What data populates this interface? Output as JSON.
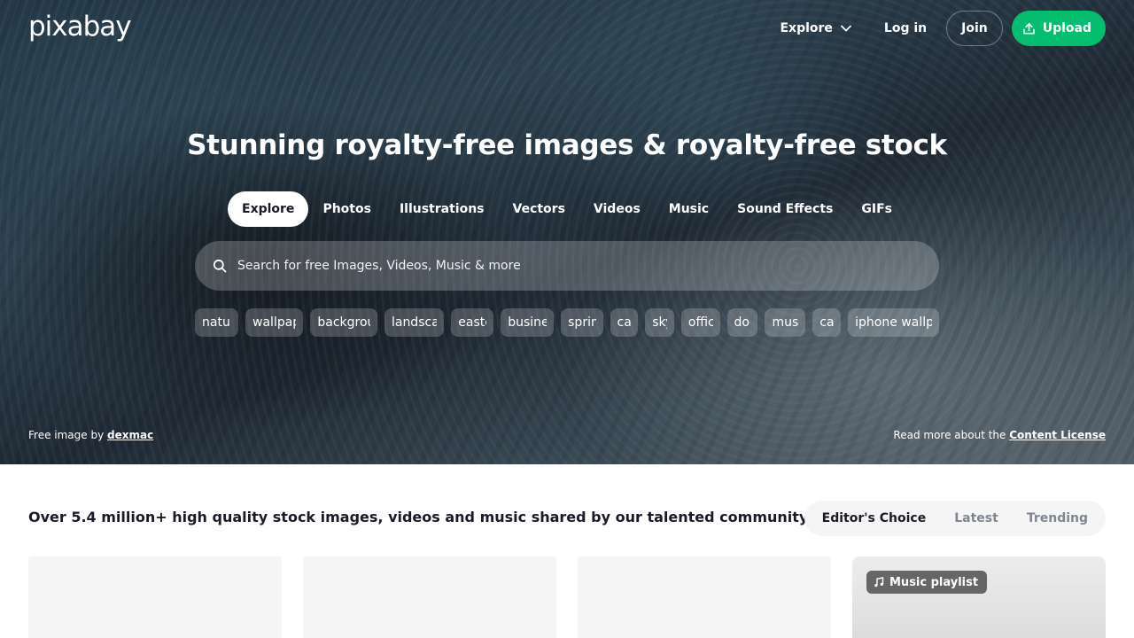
{
  "header": {
    "logo": "pixabay",
    "nav": {
      "explore_label": "Explore",
      "login_label": "Log in",
      "join_label": "Join",
      "upload_label": "Upload"
    }
  },
  "hero": {
    "headline": "Stunning royalty-free images & royalty-free stock",
    "tabs": [
      {
        "label": "Explore",
        "active": true
      },
      {
        "label": "Photos"
      },
      {
        "label": "Illustrations"
      },
      {
        "label": "Vectors"
      },
      {
        "label": "Videos"
      },
      {
        "label": "Music"
      },
      {
        "label": "Sound Effects"
      },
      {
        "label": "GIFs"
      }
    ],
    "search": {
      "placeholder": "Search for free Images, Videos, Music & more",
      "icon": "search-icon"
    },
    "chips": [
      "nature",
      "wallpaper",
      "background",
      "landscape",
      "easter",
      "business",
      "spring",
      "cat",
      "sky",
      "office",
      "dog",
      "music",
      "car",
      "iphone wallpaper"
    ],
    "credit": {
      "prefix": "Free image by ",
      "author": "dexmac"
    },
    "license": {
      "prefix": "Read more about the ",
      "link": "Content License"
    }
  },
  "main": {
    "tagline": "Over 5.4 million+ high quality stock images, videos and music shared by our talented community.",
    "sort_options": [
      {
        "label": "Editor's Choice",
        "active": true
      },
      {
        "label": "Latest"
      },
      {
        "label": "Trending"
      }
    ],
    "playlist_badge": "Music playlist"
  },
  "colors": {
    "accent": "#02be6e",
    "text_dark": "#191b26",
    "muted": "#80868f"
  }
}
